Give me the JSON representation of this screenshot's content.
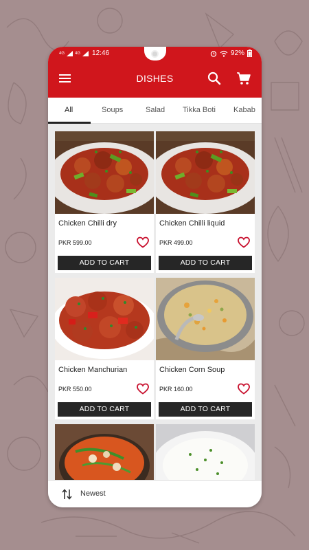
{
  "status_bar": {
    "network_tag_1": "4G",
    "network_tag_2": "4G",
    "time": "12:46",
    "battery": "92%"
  },
  "app_bar": {
    "title": "DISHES",
    "icons": [
      "menu-icon",
      "search-icon",
      "cart-icon"
    ]
  },
  "tabs": [
    {
      "label": "All",
      "active": true
    },
    {
      "label": "Soups",
      "active": false
    },
    {
      "label": "Salad",
      "active": false
    },
    {
      "label": "Tikka Boti",
      "active": false
    },
    {
      "label": "Kabab",
      "active": false
    }
  ],
  "dishes": [
    {
      "name": "Chicken Chilli dry",
      "price": "PKR 599.00",
      "button": "ADD TO CART"
    },
    {
      "name": "Chicken Chilli liquid",
      "price": "PKR 499.00",
      "button": "ADD TO CART"
    },
    {
      "name": "Chicken Manchurian",
      "price": "PKR 550.00",
      "button": "ADD TO CART"
    },
    {
      "name": "Chicken Corn Soup",
      "price": "PKR 160.00",
      "button": "ADD TO CART"
    }
  ],
  "sort": {
    "label": "Newest"
  },
  "colors": {
    "primary": "#d0161c",
    "background": "#a58e8f",
    "button": "#262626",
    "heart": "#c8102e"
  }
}
